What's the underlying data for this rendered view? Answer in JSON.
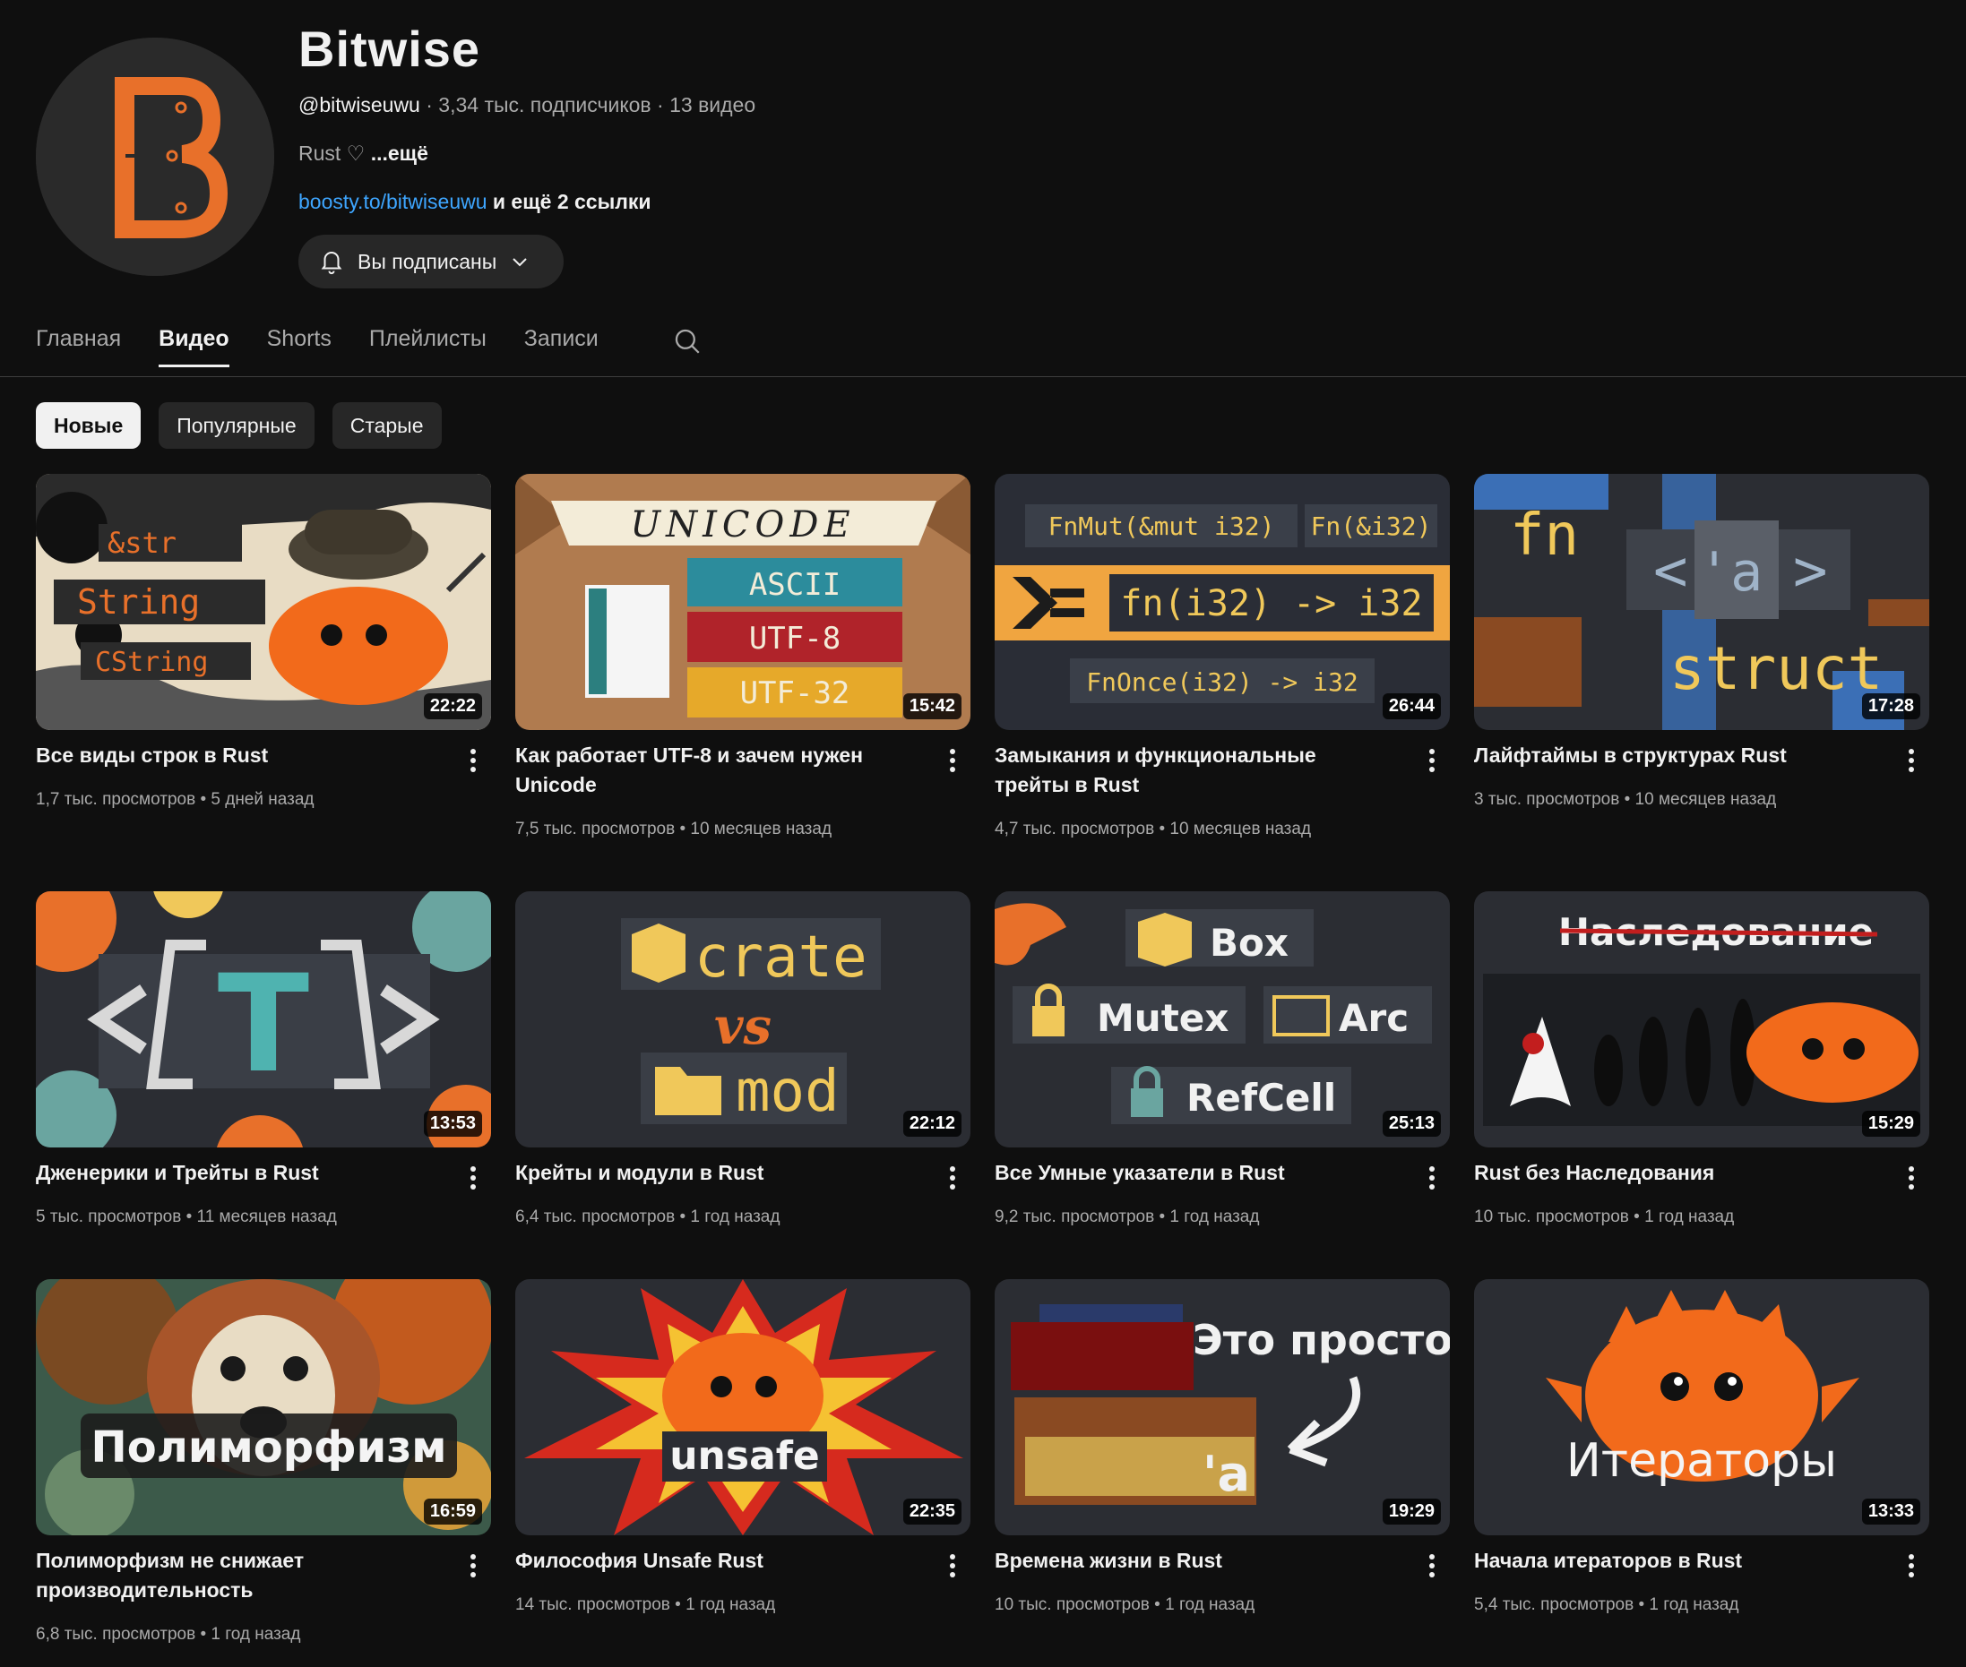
{
  "channel": {
    "name": "Bitwise",
    "handle": "@bitwiseuwu",
    "stats": " · 3,34 тыс. подписчиков · 13 видео",
    "description": "Rust ♡ ",
    "more_label": "...ещё",
    "link": "boosty.to/bitwiseuwu",
    "links_more": " и ещё 2 ссылки",
    "subscribe_label": "Вы подписаны",
    "accent_color": "#e8702a"
  },
  "tabs": [
    {
      "label": "Главная"
    },
    {
      "label": "Видео"
    },
    {
      "label": "Shorts"
    },
    {
      "label": "Плейлисты"
    },
    {
      "label": "Записи"
    }
  ],
  "chips": [
    {
      "label": "Новые"
    },
    {
      "label": "Популярные"
    },
    {
      "label": "Старые"
    }
  ],
  "videos": [
    {
      "title": "Все виды строк в Rust",
      "meta": "1,7 тыс. просмотров • 5 дней назад",
      "duration": "22:22",
      "thumb_text": [
        "&str",
        "String",
        "CString"
      ]
    },
    {
      "title": "Как работает UTF-8 и зачем нужен Unicode",
      "meta": "7,5 тыс. просмотров • 10 месяцев назад",
      "duration": "15:42",
      "thumb_text": [
        "UNICODE",
        "ASCII",
        "UTF-8",
        "UTF-32"
      ]
    },
    {
      "title": "Замыкания и функциональные трейты в Rust",
      "meta": "4,7 тыс. просмотров • 10 месяцев назад",
      "duration": "26:44",
      "thumb_text": [
        "FnMut(&mut i32)",
        "Fn(&i32)",
        "fn(i32) -> i32",
        "FnOnce(i32) -> i32"
      ]
    },
    {
      "title": "Лайфтаймы в структурах Rust",
      "meta": "3 тыс. просмотров • 10 месяцев назад",
      "duration": "17:28",
      "thumb_text": [
        "fn",
        "<",
        "'a",
        ">",
        "struct"
      ]
    },
    {
      "title": "Дженерики и Трейты в Rust",
      "meta": "5 тыс. просмотров • 11 месяцев назад",
      "duration": "13:53",
      "thumb_text": [
        "T"
      ]
    },
    {
      "title": "Крейты и модули в Rust",
      "meta": "6,4 тыс. просмотров • 1 год назад",
      "duration": "22:12",
      "thumb_text": [
        "crate",
        "vs",
        "mod"
      ]
    },
    {
      "title": "Все Умные указатели в Rust",
      "meta": "9,2 тыс. просмотров • 1 год назад",
      "duration": "25:13",
      "thumb_text": [
        "Box",
        "Mutex",
        "Arc",
        "RefCell"
      ]
    },
    {
      "title": "Rust без Наследования",
      "meta": "10 тыс. просмотров • 1 год назад",
      "duration": "15:29",
      "thumb_text": [
        "Наследование"
      ]
    },
    {
      "title": "Полиморфизм не снижает производительность",
      "meta": "6,8 тыс. просмотров • 1 год назад",
      "duration": "16:59",
      "thumb_text": [
        "Полиморфизм"
      ]
    },
    {
      "title": "Философия Unsafe Rust",
      "meta": "14 тыс. просмотров • 1 год назад",
      "duration": "22:35",
      "thumb_text": [
        "unsafe"
      ]
    },
    {
      "title": "Времена жизни в Rust",
      "meta": "10 тыс. просмотров • 1 год назад",
      "duration": "19:29",
      "thumb_text": [
        "Это просто",
        "'a"
      ]
    },
    {
      "title": "Начала итераторов в Rust",
      "meta": "5,4 тыс. просмотров • 1 год назад",
      "duration": "13:33",
      "thumb_text": [
        "Итераторы"
      ]
    }
  ]
}
